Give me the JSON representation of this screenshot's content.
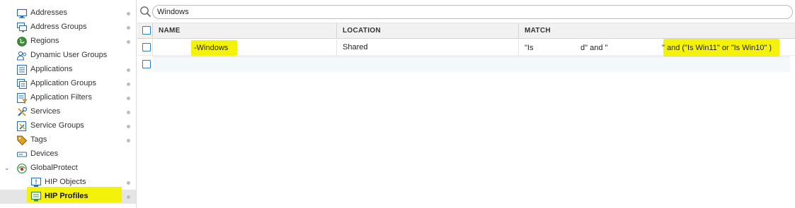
{
  "sidebar": {
    "items": [
      {
        "label": "Addresses",
        "icon": "addresses-icon"
      },
      {
        "label": "Address Groups",
        "icon": "address-groups-icon"
      },
      {
        "label": "Regions",
        "icon": "regions-icon"
      },
      {
        "label": "Dynamic User Groups",
        "icon": "dynamic-user-groups-icon"
      },
      {
        "label": "Applications",
        "icon": "applications-icon"
      },
      {
        "label": "Application Groups",
        "icon": "application-groups-icon"
      },
      {
        "label": "Application Filters",
        "icon": "application-filters-icon"
      },
      {
        "label": "Services",
        "icon": "services-icon"
      },
      {
        "label": "Service Groups",
        "icon": "service-groups-icon"
      },
      {
        "label": "Tags",
        "icon": "tags-icon"
      },
      {
        "label": "Devices",
        "icon": "devices-icon"
      },
      {
        "label": "GlobalProtect",
        "icon": "globalprotect-icon"
      },
      {
        "label": "HIP Objects",
        "icon": "hip-objects-icon"
      },
      {
        "label": "HIP Profiles",
        "icon": "hip-profiles-icon"
      }
    ]
  },
  "search": {
    "value": "Windows"
  },
  "table": {
    "columns": [
      "NAME",
      "LOCATION",
      "MATCH"
    ],
    "rows": [
      {
        "name": "-Windows",
        "location": "Shared",
        "match_part1": "\"Is",
        "match_part2": "d\" and \"",
        "match_part3": "\" and (\"Is Win11\" or \"Is Win10\" )"
      }
    ]
  },
  "colors": {
    "highlight": "#f4f20a",
    "checkbox_border": "#2f7fbf",
    "selected_nav": "#e5e5e5"
  }
}
